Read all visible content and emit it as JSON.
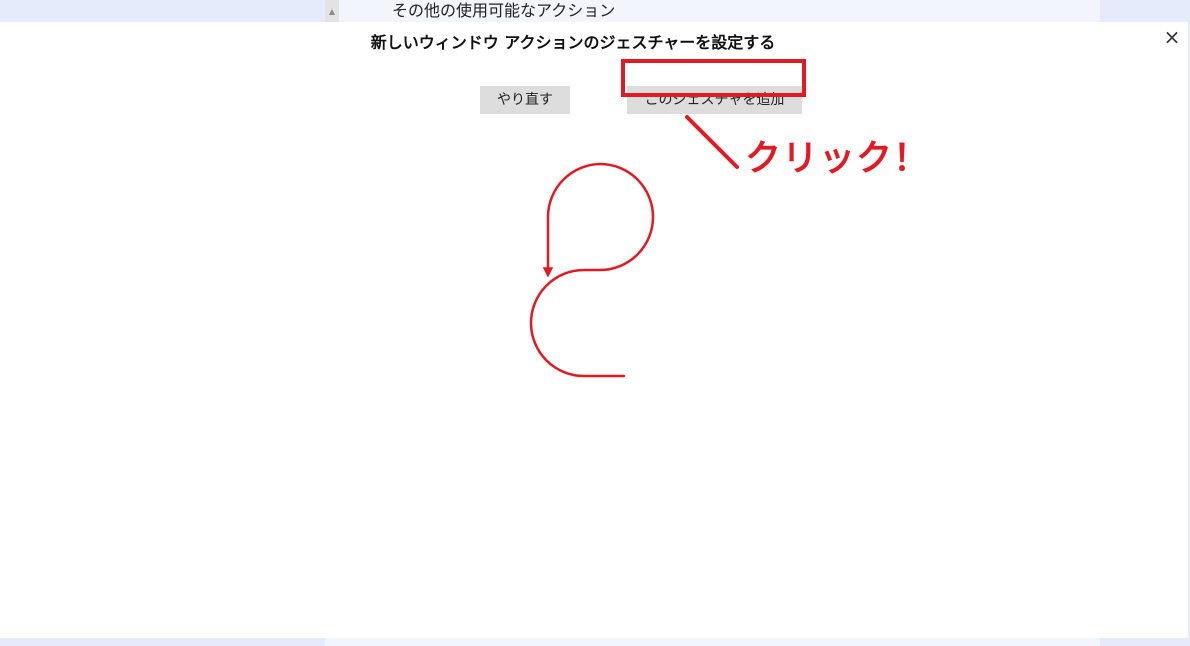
{
  "background": {
    "section_title": "その他の使用可能なアクション",
    "scroll_arrow": "▲"
  },
  "dialog": {
    "title": "新しいウィンドウ アクションのジェスチャーを設定する",
    "close_label": "×",
    "redo_label": "やり直す",
    "add_gesture_label": "このジェスチャを追加"
  },
  "annotation": {
    "text": "クリック！",
    "color": "#e01b24"
  },
  "gesture": {
    "color": "#e01b24",
    "icon": "gesture-stroke"
  }
}
